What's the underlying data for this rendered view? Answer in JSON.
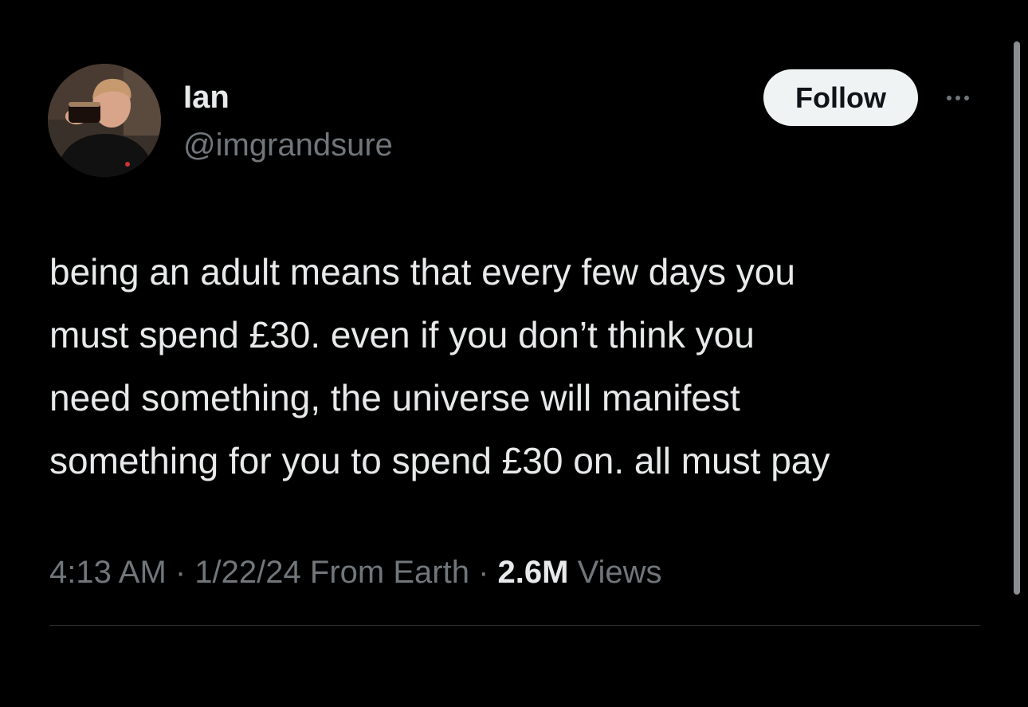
{
  "author": {
    "display_name": "Ian",
    "handle": "@imgrandsure",
    "avatar_icon": "profile-photo"
  },
  "actions": {
    "follow_label": "Follow",
    "more_icon": "more-horizontal-icon"
  },
  "tweet": {
    "lines": [
      "being an adult means that every few days you",
      "must spend £30. even if you don’t think you",
      "need something, the universe will manifest",
      "something for you to spend £30 on. all must pay"
    ]
  },
  "meta": {
    "time": "4:13 AM",
    "separator": " · ",
    "date": "1/22/24",
    "source": "From Earth",
    "views_count": "2.6M",
    "views_label": "Views"
  },
  "colors": {
    "background": "#000000",
    "primary_text": "#e7e9ea",
    "secondary_text": "#71767b",
    "follow_button_bg": "#eff3f4",
    "divider": "#2f3336"
  }
}
